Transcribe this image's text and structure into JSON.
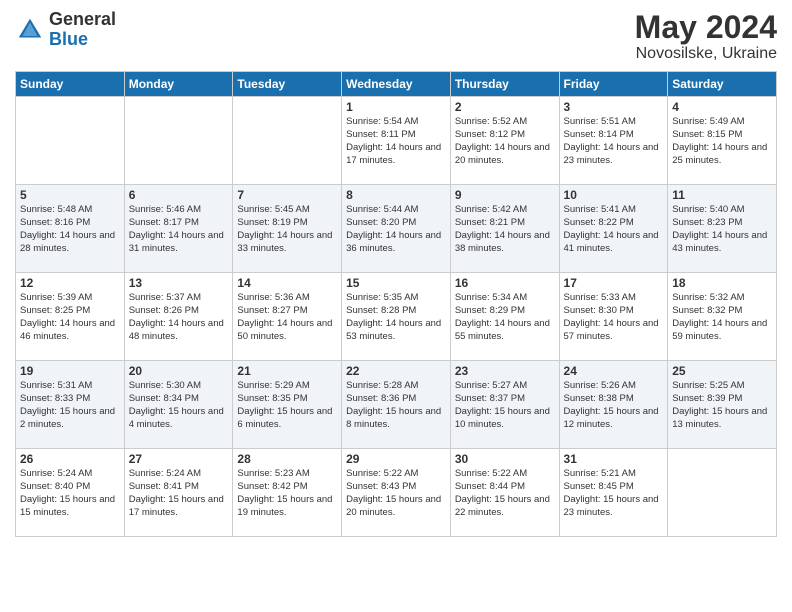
{
  "logo": {
    "general": "General",
    "blue": "Blue"
  },
  "header": {
    "month_year": "May 2024",
    "location": "Novosilske, Ukraine"
  },
  "weekdays": [
    "Sunday",
    "Monday",
    "Tuesday",
    "Wednesday",
    "Thursday",
    "Friday",
    "Saturday"
  ],
  "weeks": [
    [
      {
        "day": "",
        "info": ""
      },
      {
        "day": "",
        "info": ""
      },
      {
        "day": "",
        "info": ""
      },
      {
        "day": "1",
        "info": "Sunrise: 5:54 AM\nSunset: 8:11 PM\nDaylight: 14 hours and 17 minutes."
      },
      {
        "day": "2",
        "info": "Sunrise: 5:52 AM\nSunset: 8:12 PM\nDaylight: 14 hours and 20 minutes."
      },
      {
        "day": "3",
        "info": "Sunrise: 5:51 AM\nSunset: 8:14 PM\nDaylight: 14 hours and 23 minutes."
      },
      {
        "day": "4",
        "info": "Sunrise: 5:49 AM\nSunset: 8:15 PM\nDaylight: 14 hours and 25 minutes."
      }
    ],
    [
      {
        "day": "5",
        "info": "Sunrise: 5:48 AM\nSunset: 8:16 PM\nDaylight: 14 hours and 28 minutes."
      },
      {
        "day": "6",
        "info": "Sunrise: 5:46 AM\nSunset: 8:17 PM\nDaylight: 14 hours and 31 minutes."
      },
      {
        "day": "7",
        "info": "Sunrise: 5:45 AM\nSunset: 8:19 PM\nDaylight: 14 hours and 33 minutes."
      },
      {
        "day": "8",
        "info": "Sunrise: 5:44 AM\nSunset: 8:20 PM\nDaylight: 14 hours and 36 minutes."
      },
      {
        "day": "9",
        "info": "Sunrise: 5:42 AM\nSunset: 8:21 PM\nDaylight: 14 hours and 38 minutes."
      },
      {
        "day": "10",
        "info": "Sunrise: 5:41 AM\nSunset: 8:22 PM\nDaylight: 14 hours and 41 minutes."
      },
      {
        "day": "11",
        "info": "Sunrise: 5:40 AM\nSunset: 8:23 PM\nDaylight: 14 hours and 43 minutes."
      }
    ],
    [
      {
        "day": "12",
        "info": "Sunrise: 5:39 AM\nSunset: 8:25 PM\nDaylight: 14 hours and 46 minutes."
      },
      {
        "day": "13",
        "info": "Sunrise: 5:37 AM\nSunset: 8:26 PM\nDaylight: 14 hours and 48 minutes."
      },
      {
        "day": "14",
        "info": "Sunrise: 5:36 AM\nSunset: 8:27 PM\nDaylight: 14 hours and 50 minutes."
      },
      {
        "day": "15",
        "info": "Sunrise: 5:35 AM\nSunset: 8:28 PM\nDaylight: 14 hours and 53 minutes."
      },
      {
        "day": "16",
        "info": "Sunrise: 5:34 AM\nSunset: 8:29 PM\nDaylight: 14 hours and 55 minutes."
      },
      {
        "day": "17",
        "info": "Sunrise: 5:33 AM\nSunset: 8:30 PM\nDaylight: 14 hours and 57 minutes."
      },
      {
        "day": "18",
        "info": "Sunrise: 5:32 AM\nSunset: 8:32 PM\nDaylight: 14 hours and 59 minutes."
      }
    ],
    [
      {
        "day": "19",
        "info": "Sunrise: 5:31 AM\nSunset: 8:33 PM\nDaylight: 15 hours and 2 minutes."
      },
      {
        "day": "20",
        "info": "Sunrise: 5:30 AM\nSunset: 8:34 PM\nDaylight: 15 hours and 4 minutes."
      },
      {
        "day": "21",
        "info": "Sunrise: 5:29 AM\nSunset: 8:35 PM\nDaylight: 15 hours and 6 minutes."
      },
      {
        "day": "22",
        "info": "Sunrise: 5:28 AM\nSunset: 8:36 PM\nDaylight: 15 hours and 8 minutes."
      },
      {
        "day": "23",
        "info": "Sunrise: 5:27 AM\nSunset: 8:37 PM\nDaylight: 15 hours and 10 minutes."
      },
      {
        "day": "24",
        "info": "Sunrise: 5:26 AM\nSunset: 8:38 PM\nDaylight: 15 hours and 12 minutes."
      },
      {
        "day": "25",
        "info": "Sunrise: 5:25 AM\nSunset: 8:39 PM\nDaylight: 15 hours and 13 minutes."
      }
    ],
    [
      {
        "day": "26",
        "info": "Sunrise: 5:24 AM\nSunset: 8:40 PM\nDaylight: 15 hours and 15 minutes."
      },
      {
        "day": "27",
        "info": "Sunrise: 5:24 AM\nSunset: 8:41 PM\nDaylight: 15 hours and 17 minutes."
      },
      {
        "day": "28",
        "info": "Sunrise: 5:23 AM\nSunset: 8:42 PM\nDaylight: 15 hours and 19 minutes."
      },
      {
        "day": "29",
        "info": "Sunrise: 5:22 AM\nSunset: 8:43 PM\nDaylight: 15 hours and 20 minutes."
      },
      {
        "day": "30",
        "info": "Sunrise: 5:22 AM\nSunset: 8:44 PM\nDaylight: 15 hours and 22 minutes."
      },
      {
        "day": "31",
        "info": "Sunrise: 5:21 AM\nSunset: 8:45 PM\nDaylight: 15 hours and 23 minutes."
      },
      {
        "day": "",
        "info": ""
      }
    ]
  ]
}
